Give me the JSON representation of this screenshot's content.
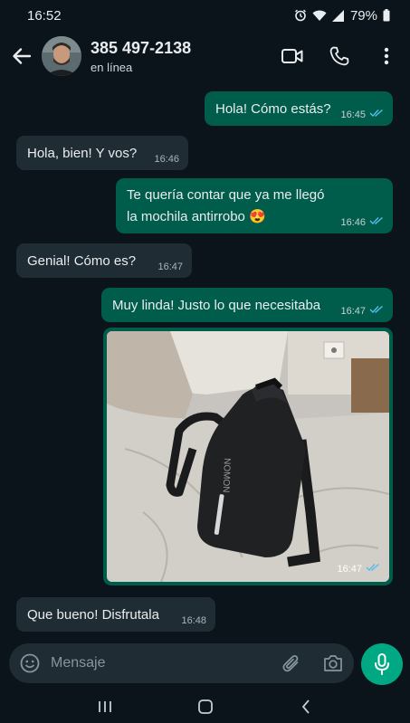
{
  "status_bar": {
    "time": "16:52",
    "battery": "79%",
    "icons": [
      "alarm-icon",
      "wifi-icon",
      "signal-icon",
      "battery-icon"
    ]
  },
  "header": {
    "contact_name": "385 497-2138",
    "contact_status": "en línea",
    "actions": [
      "video-call-icon",
      "voice-call-icon",
      "more-options-icon"
    ]
  },
  "messages": [
    {
      "direction": "outgoing",
      "text": "Hola! Cómo estás?",
      "time": "16:45",
      "read": true
    },
    {
      "direction": "incoming",
      "text": "Hola, bien! Y vos?",
      "time": "16:46"
    },
    {
      "direction": "outgoing",
      "text_line1": "Te quería contar que ya me llegó",
      "text_line2": "la mochila antirrobo 😍",
      "time": "16:46",
      "read": true
    },
    {
      "direction": "incoming",
      "text": "Genial! Cómo es?",
      "time": "16:47"
    },
    {
      "direction": "outgoing",
      "text": "Muy linda! Justo lo que necesitaba",
      "time": "16:47",
      "read": true
    },
    {
      "direction": "outgoing",
      "type": "image",
      "image_brand_text": "NOMON",
      "time": "16:47",
      "read": true
    },
    {
      "direction": "incoming",
      "text": "Que bueno! Disfrutala",
      "time": "16:48"
    }
  ],
  "composer": {
    "placeholder": "Mensaje"
  },
  "colors": {
    "background": "#0b141a",
    "outgoing_bubble": "#005c4b",
    "incoming_bubble": "#202c33",
    "read_ticks": "#53bdeb",
    "accent": "#00a884"
  }
}
